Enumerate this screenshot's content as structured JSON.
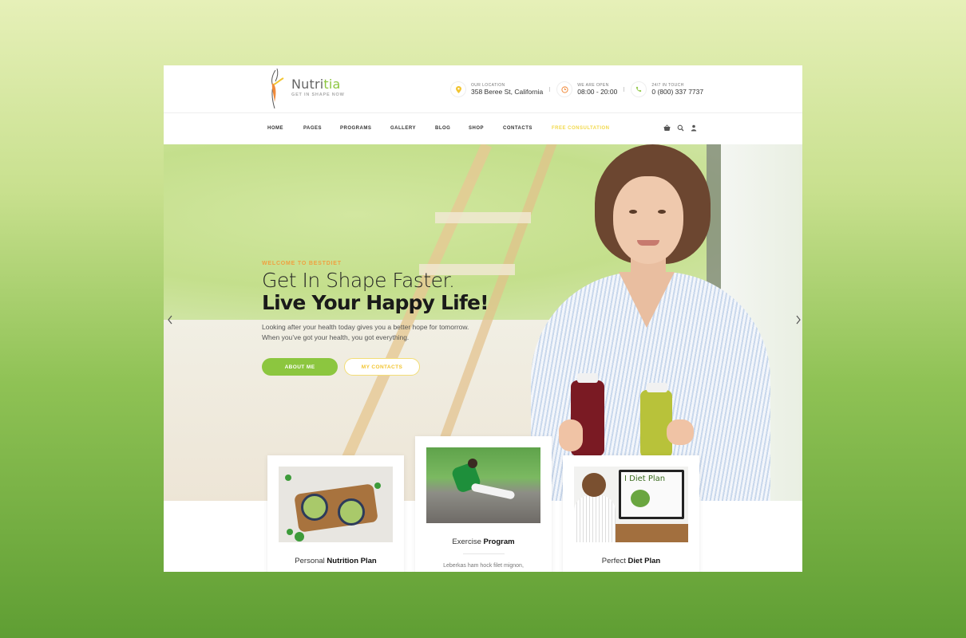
{
  "brand": {
    "name_main": "Nutri",
    "name_accent": "tia",
    "tagline": "GET IN SHAPE NOW",
    "accent_color": "#8cc63f",
    "highlight_color": "#f2c531"
  },
  "contacts": [
    {
      "icon": "map-pin-icon",
      "glyph": "📍",
      "label": "OUR LOCATION",
      "value": "358 Beree St, California",
      "color": "#f2c531"
    },
    {
      "icon": "clock-icon",
      "glyph": "◷",
      "label": "WE ARE OPEN",
      "value": "08:00 - 20:00",
      "color": "#f08a3a"
    },
    {
      "icon": "phone-icon",
      "glyph": "✆",
      "label": "24/7 IN TOUCH",
      "value": "0 (800) 337 7737",
      "color": "#8cc63f"
    }
  ],
  "nav": {
    "items": [
      "HOME",
      "PAGES",
      "PROGRAMS",
      "GALLERY",
      "BLOG",
      "SHOP",
      "CONTACTS",
      "FREE CONSULTATION"
    ],
    "highlighted_item": "FREE CONSULTATION",
    "tools": [
      {
        "icon": "basket-icon",
        "glyph": "⛀"
      },
      {
        "icon": "search-icon",
        "glyph": "⚲"
      },
      {
        "icon": "user-icon",
        "glyph": "♟"
      }
    ]
  },
  "hero": {
    "eyebrow": "WELCOME TO BESTDIET",
    "title_line1": "Get In Shape Faster.",
    "title_line2": "Live Your Happy Life!",
    "paragraph_line1": "Looking after your health today gives you a better hope for tomorrow.",
    "paragraph_line2": "When you’ve got your health, you got everything.",
    "primary_button": "ABOUT ME",
    "secondary_button": "MY CONTACTS",
    "prev_arrow": "‹",
    "next_arrow": "›"
  },
  "cards": [
    {
      "title_light": "Personal ",
      "title_bold": "Nutrition Plan"
    },
    {
      "title_light": "Exercise ",
      "title_bold": "Program",
      "description": "Leberkas ham hock filet mignon,"
    },
    {
      "title_light": "Perfect ",
      "title_bold": "Diet Plan",
      "screen_text": "I Diet Plan"
    }
  ]
}
